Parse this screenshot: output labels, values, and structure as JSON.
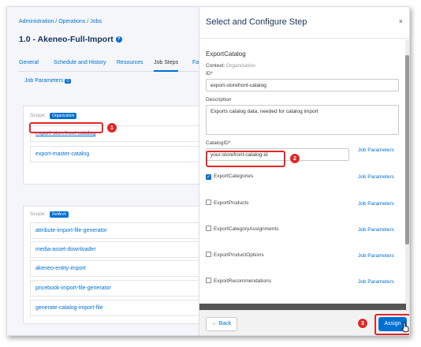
{
  "breadcrumb": [
    "Administration",
    "Operations",
    "Jobs"
  ],
  "page_title": "1.0 - Akeneo-Full-Import",
  "tabs": [
    {
      "label": "General"
    },
    {
      "label": "Schedule and History"
    },
    {
      "label": "Resources"
    },
    {
      "label": "Job Steps"
    },
    {
      "label": "Fa"
    }
  ],
  "job_parameters": {
    "label": "Job Parameters",
    "count": "0"
  },
  "panel1": {
    "scope_label": "Scope:",
    "scope_badge": "Organization",
    "rows": [
      "export-storefront-catalog",
      "export-master-catalog"
    ]
  },
  "panel2": {
    "scope_label": "Scope:",
    "scope_badge": "RefArch",
    "rows": [
      "attribute-import-file-generator",
      "media-asset-downloader",
      "akeneo-entity-import",
      "pricebook-import-file-generator",
      "generate-catalog-import-file"
    ]
  },
  "modal": {
    "title": "Select and Configure Step",
    "close": "×",
    "step_name": "ExportCatalog",
    "context_label": "Context:",
    "context_value": "Organization",
    "id_label": "ID*",
    "id_value": "export-storefront-catalog",
    "desc_label": "Description",
    "desc_value": "Exports catalog data, needed for catalog import",
    "catalogid_label": "CatalogID*",
    "catalogid_value": "your-storefront-catalog-id",
    "job_params_link": "Job Parameters",
    "checkboxes": [
      {
        "label": "ExportCategories",
        "checked": true
      },
      {
        "label": "ExportProducts",
        "checked": false
      },
      {
        "label": "ExportCategoryAssignments",
        "checked": false
      },
      {
        "label": "ExportProductOptions",
        "checked": false
      },
      {
        "label": "ExportRecommendations",
        "checked": false
      }
    ],
    "back_label": "Back",
    "assign_label": "Assign"
  },
  "markers": [
    "1",
    "2",
    "3"
  ],
  "colors": {
    "accent": "#0070d2",
    "marker": "#e0282a",
    "title": "#16325c"
  }
}
